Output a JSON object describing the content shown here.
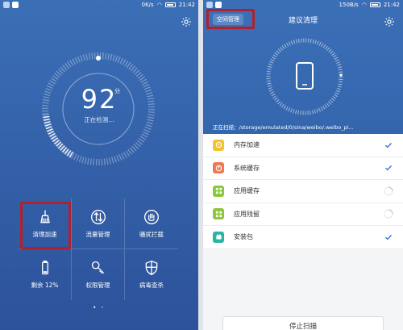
{
  "left_screen": {
    "status": {
      "speed": "0K/s",
      "time": "21:42"
    },
    "dial": {
      "score": "92",
      "unit": "分",
      "status_text": "正在检测..."
    },
    "tiles": [
      {
        "label": "清理加速",
        "icon": "broom-icon"
      },
      {
        "label": "流量管理",
        "icon": "arrows-updown-icon"
      },
      {
        "label": "骚扰拦截",
        "icon": "hand-icon"
      },
      {
        "label": "剩余 12%",
        "icon": "battery-icon"
      },
      {
        "label": "权限管理",
        "icon": "key-icon"
      },
      {
        "label": "病毒查杀",
        "icon": "shield-icon"
      }
    ],
    "page_dots": "•"
  },
  "right_screen": {
    "status": {
      "speed": "150B/s",
      "time": "21:42"
    },
    "space_button": "空间管理",
    "title": "建议清理",
    "scan_path": "正在扫描：/storage/emulated/0/sina/weibo/.weibo_pi...",
    "items": [
      {
        "label": "内存加速",
        "icon": "memory-icon",
        "color": "#f2c232",
        "status": "done"
      },
      {
        "label": "系统缓存",
        "icon": "system-cache-icon",
        "color": "#ee7a55",
        "status": "done"
      },
      {
        "label": "应用缓存",
        "icon": "app-cache-icon",
        "color": "#8cc63f",
        "status": "scanning"
      },
      {
        "label": "应用残留",
        "icon": "app-residual-icon",
        "color": "#8cc63f",
        "status": "scanning"
      },
      {
        "label": "安装包",
        "icon": "package-icon",
        "color": "#2bb3a4",
        "status": "done"
      }
    ],
    "stop_button": "停止扫描"
  },
  "colors": {
    "header_blue": "#3b6fb6",
    "check_blue": "#2e6fd0",
    "highlight_red": "#b3202b"
  }
}
